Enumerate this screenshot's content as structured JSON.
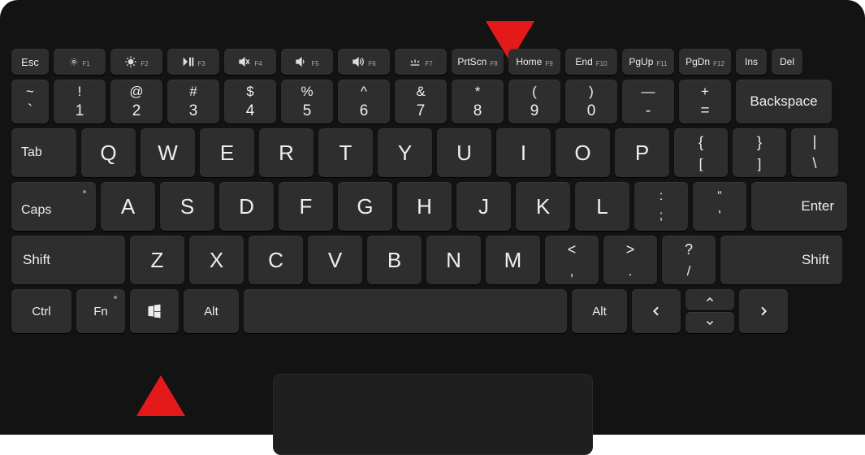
{
  "highlights": {
    "top": {
      "target_key": "PrtScn",
      "direction": "down"
    },
    "bottom": {
      "target_key": "Windows",
      "direction": "up"
    }
  },
  "fn_row": {
    "esc": "Esc",
    "f1_sub": "F1",
    "f2_sub": "F2",
    "f3_sub": "F3",
    "f4_sub": "F4",
    "f5_sub": "F5",
    "f6_sub": "F6",
    "f7_sub": "F7",
    "f8": "PrtScn",
    "f8_sub": "F8",
    "f9": "Home",
    "f9_sub": "F9",
    "f10": "End",
    "f10_sub": "F10",
    "f11": "PgUp",
    "f11_sub": "F11",
    "f12": "PgDn",
    "f12_sub": "F12",
    "ins": "Ins",
    "del": "Del"
  },
  "num_row": {
    "tilde_top": "~",
    "tilde_bot": "`",
    "k1_top": "!",
    "k1_bot": "1",
    "k2_top": "@",
    "k2_bot": "2",
    "k3_top": "#",
    "k3_bot": "3",
    "k4_top": "$",
    "k4_bot": "4",
    "k5_top": "%",
    "k5_bot": "5",
    "k6_top": "^",
    "k6_bot": "6",
    "k7_top": "&",
    "k7_bot": "7",
    "k8_top": "*",
    "k8_bot": "8",
    "k9_top": "(",
    "k9_bot": "9",
    "k0_top": ")",
    "k0_bot": "0",
    "dash_top": "—",
    "dash_bot": "-",
    "eq_top": "+",
    "eq_bot": "=",
    "backspace": "Backspace"
  },
  "q_row": {
    "tab": "Tab",
    "q": "Q",
    "w": "W",
    "e": "E",
    "r": "R",
    "t": "T",
    "y": "Y",
    "u": "U",
    "i": "I",
    "o": "O",
    "p": "P",
    "lb_top": "{",
    "lb_bot": "[",
    "rb_top": "}",
    "rb_bot": "]",
    "pipe_top": "|",
    "pipe_bot": "\\"
  },
  "a_row": {
    "caps": "Caps",
    "a": "A",
    "s": "S",
    "d": "D",
    "f": "F",
    "g": "G",
    "h": "H",
    "j": "J",
    "k": "K",
    "l": "L",
    "semi_top": ":",
    "semi_bot": ";",
    "quote_top": "“",
    "quote_bot": "'",
    "enter": "Enter"
  },
  "z_row": {
    "shift_l": "Shift",
    "z": "Z",
    "x": "X",
    "c": "C",
    "v": "V",
    "b": "B",
    "n": "N",
    "m": "M",
    "comma_top": "<",
    "comma_bot": ",",
    "dot_top": ">",
    "dot_bot": ".",
    "slash_top": "?",
    "slash_bot": "/",
    "shift_r": "Shift"
  },
  "b_row": {
    "ctrl": "Ctrl",
    "fn": "Fn",
    "alt_l": "Alt",
    "alt_r": "Alt",
    "left": "‹",
    "right": "›",
    "up": "˄",
    "down": "˅"
  }
}
